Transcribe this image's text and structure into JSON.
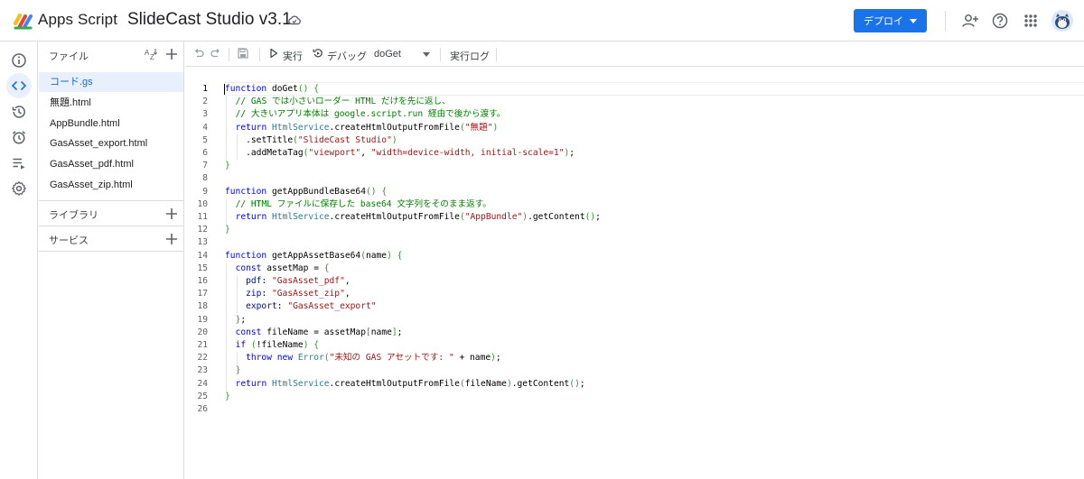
{
  "header": {
    "app_name": "Apps Script",
    "project_title": "SlideCast Studio v3.1",
    "deploy_label": "デプロイ",
    "colors": {
      "accent": "#1a73e8"
    },
    "icons": [
      "apps-script-logo",
      "cloud-icon",
      "add-person-icon",
      "help-icon",
      "apps-grid-icon",
      "avatar"
    ]
  },
  "rail": {
    "items": [
      "info-icon",
      "code-icon",
      "history-icon",
      "alarm-icon",
      "executions-icon",
      "settings-icon"
    ],
    "active": "code-icon"
  },
  "files": {
    "title": "ファイル",
    "items": [
      {
        "name": "コード.gs",
        "active": true
      },
      {
        "name": "無題.html",
        "active": false
      },
      {
        "name": "AppBundle.html",
        "active": false
      },
      {
        "name": "GasAsset_export.html",
        "active": false
      },
      {
        "name": "GasAsset_pdf.html",
        "active": false
      },
      {
        "name": "GasAsset_zip.html",
        "active": false
      }
    ],
    "sections": {
      "libraries": "ライブラリ",
      "services": "サービス"
    }
  },
  "toolbar": {
    "run_label": "実行",
    "debug_label": "デバッグ",
    "function_select": "doGet",
    "log_label": "実行ログ"
  },
  "editor": {
    "lines": [
      "function doGet() {",
      "  // GAS では小さいローダー HTML だけを先に返し、",
      "  // 大きいアプリ本体は google.script.run 経由で後から渡す。",
      "  return HtmlService.createHtmlOutputFromFile(\"無題\")",
      "    .setTitle(\"SlideCast Studio\")",
      "    .addMetaTag(\"viewport\", \"width=device-width, initial-scale=1\");",
      "}",
      "",
      "function getAppBundleBase64() {",
      "  // HTML ファイルに保存した base64 文字列をそのまま返す。",
      "  return HtmlService.createHtmlOutputFromFile(\"AppBundle\").getContent();",
      "}",
      "",
      "function getAppAssetBase64(name) {",
      "  const assetMap = {",
      "    pdf: \"GasAsset_pdf\",",
      "    zip: \"GasAsset_zip\",",
      "    export: \"GasAsset_export\"",
      "  };",
      "  const fileName = assetMap[name];",
      "  if (!fileName) {",
      "    throw new Error(\"未知の GAS アセットです: \" + name);",
      "  }",
      "  return HtmlService.createHtmlOutputFromFile(fileName).getContent();",
      "}",
      ""
    ],
    "current_line": 1
  }
}
